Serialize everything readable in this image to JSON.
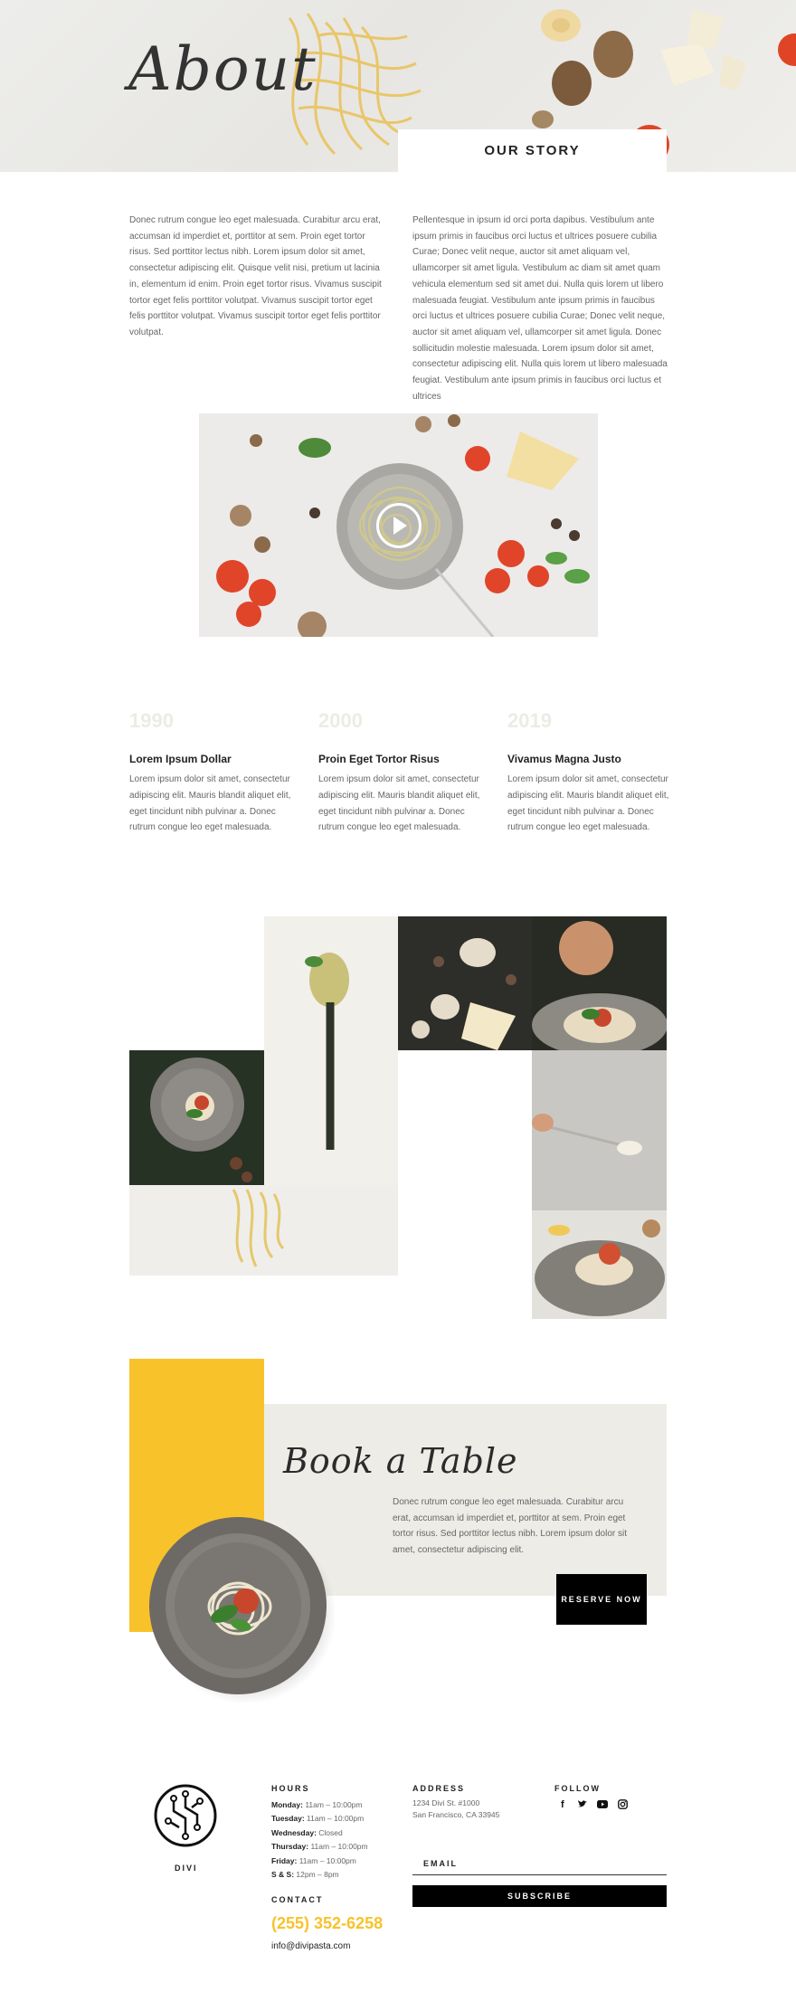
{
  "hero": {
    "title": "About",
    "story_label": "OUR STORY"
  },
  "intro": {
    "left_paragraph": "Donec rutrum congue leo eget malesuada. Curabitur arcu erat, accumsan id imperdiet et, porttitor at sem. Proin eget tortor risus. Sed porttitor lectus nibh. Lorem ipsum dolor sit amet, consectetur adipiscing elit. Quisque velit nisi, pretium ut lacinia in, elementum id enim. Proin eget tortor risus. Vivamus suscipit tortor eget felis porttitor volutpat. Vivamus suscipit tortor eget felis porttitor volutpat. Vivamus suscipit tortor eget felis porttitor volutpat.",
    "right_paragraph": "Pellentesque in ipsum id orci porta dapibus. Vestibulum ante ipsum primis in faucibus orci luctus et ultrices posuere cubilia Curae; Donec velit neque, auctor sit amet aliquam vel, ullamcorper sit amet ligula. Vestibulum ac diam sit amet quam vehicula elementum sed sit amet dui. Nulla quis lorem ut libero malesuada feugiat. Vestibulum ante ipsum primis in faucibus orci luctus et ultrices posuere cubilia Curae; Donec velit neque, auctor sit amet aliquam vel, ullamcorper sit amet ligula. Donec sollicitudin molestie malesuada. Lorem ipsum dolor sit amet, consectetur adipiscing elit. Nulla quis lorem ut libero malesuada feugiat. Vestibulum ante ipsum primis in faucibus orci luctus et ultrices"
  },
  "video": {
    "play_icon": "play-icon"
  },
  "timeline": [
    {
      "year": "1990",
      "title": "Lorem Ipsum Dollar",
      "text": "Lorem ipsum dolor sit amet, consectetur adipiscing elit. Mauris blandit aliquet elit, eget tincidunt nibh pulvinar a. Donec rutrum congue leo eget malesuada."
    },
    {
      "year": "2000",
      "title": "Proin Eget Tortor Risus",
      "text": "Lorem ipsum dolor sit amet, consectetur adipiscing elit. Mauris blandit aliquet elit, eget tincidunt nibh pulvinar a. Donec rutrum congue leo eget malesuada."
    },
    {
      "year": "2019",
      "title": "Vivamus Magna Justo",
      "text": "Lorem ipsum dolor sit amet, consectetur adipiscing elit. Mauris blandit aliquet elit, eget tincidunt nibh pulvinar a. Donec rutrum congue leo eget malesuada."
    }
  ],
  "book": {
    "title": "Book a Table",
    "text": "Donec rutrum congue leo eget malesuada. Curabitur arcu erat, accumsan id imperdiet et, porttitor at sem. Proin eget tortor risus. Sed porttitor lectus nibh. Lorem ipsum dolor sit amet, consectetur adipiscing elit.",
    "button": "RESERVE NOW"
  },
  "footer": {
    "logo_text": "DIVI",
    "hours_heading": "HOURS",
    "hours": [
      {
        "day": "Monday:",
        "time": " 11am – 10:00pm"
      },
      {
        "day": "Tuesday:",
        "time": " 11am – 10:00pm"
      },
      {
        "day": "Wednesday:",
        "time": " Closed"
      },
      {
        "day": "Thursday:",
        "time": " 11am – 10:00pm"
      },
      {
        "day": "Friday:",
        "time": " 11am – 10:00pm"
      },
      {
        "day": "S & S:",
        "time": " 12pm – 8pm"
      }
    ],
    "contact_heading": "CONTACT",
    "phone": "(255) 352-6258",
    "email": "info@divipasta.com",
    "address_heading": "ADDRESS",
    "address_line1": "1234 Divi St. #1000",
    "address_line2": "San Francisco, CA 33945",
    "follow_heading": "FOLLOW",
    "social_icons": [
      "facebook-icon",
      "twitter-icon",
      "youtube-icon",
      "instagram-icon"
    ],
    "email_placeholder": "EMAIL",
    "subscribe_label": "SUBSCRIBE"
  },
  "colors": {
    "accent_yellow": "#f8c22b",
    "beige": "#eeece7",
    "dark": "#000000"
  }
}
